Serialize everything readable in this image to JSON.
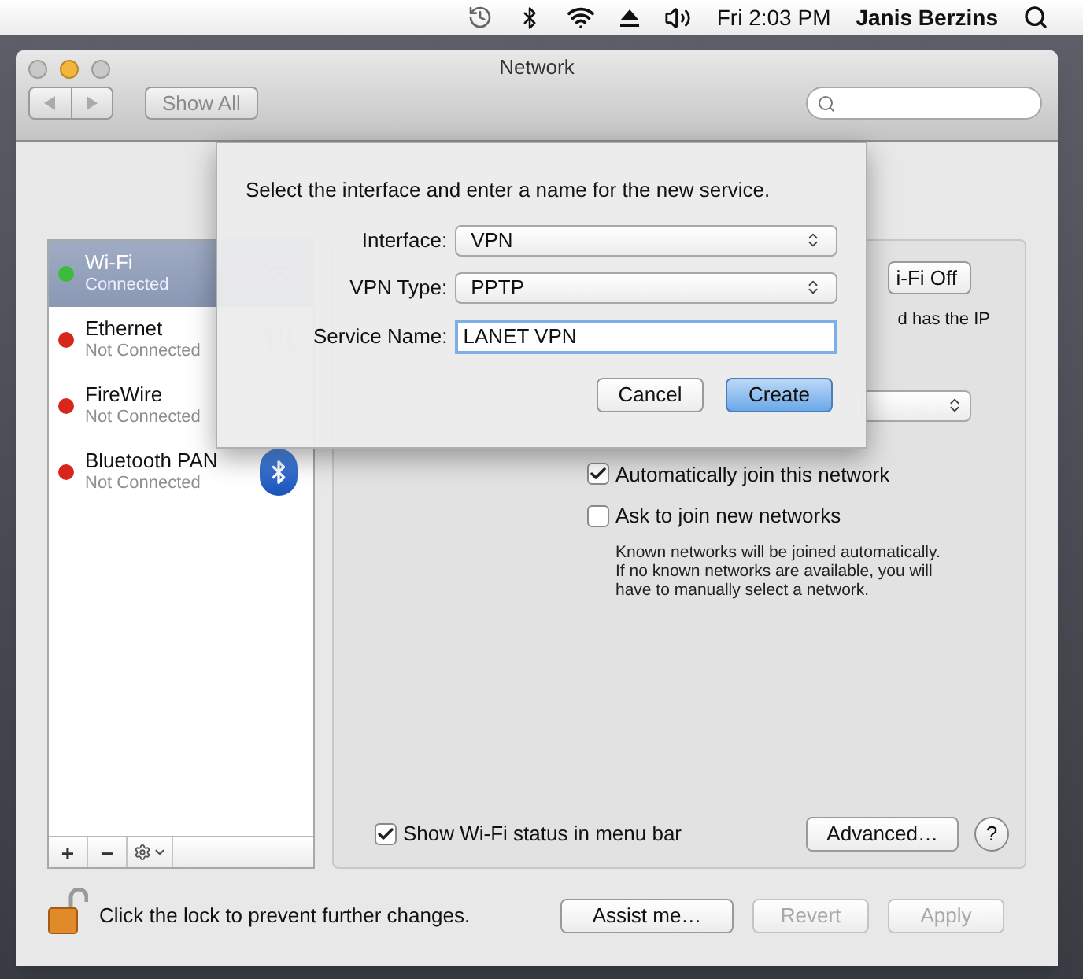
{
  "menubar": {
    "clock": "Fri 2:03 PM",
    "user": "Janis Berzins"
  },
  "window": {
    "title": "Network",
    "show_all": "Show All"
  },
  "services": [
    {
      "name": "Wi-Fi",
      "status": "Connected",
      "selected": true,
      "color": "#3dbb3a",
      "kind": "wifi"
    },
    {
      "name": "Ethernet",
      "status": "Not Connected",
      "selected": false,
      "color": "#d9261c",
      "kind": "ethernet"
    },
    {
      "name": "FireWire",
      "status": "Not Connected",
      "selected": false,
      "color": "#d9261c",
      "kind": "firewire"
    },
    {
      "name": "Bluetooth PAN",
      "status": "Not Connected",
      "selected": false,
      "color": "#d9261c",
      "kind": "bluetooth"
    }
  ],
  "list_controls": [
    "+",
    "−"
  ],
  "sheet": {
    "prompt": "Select the interface and enter a name for the new service.",
    "fields": [
      {
        "label": "Interface:",
        "kind": "select",
        "value": "VPN"
      },
      {
        "label": "VPN Type:",
        "kind": "select",
        "value": "PPTP"
      },
      {
        "label": "Service Name:",
        "kind": "text",
        "value": "LANET VPN"
      }
    ],
    "buttons": [
      {
        "label": "Cancel",
        "default": false
      },
      {
        "label": "Create",
        "default": true
      }
    ]
  },
  "detail": {
    "power_button": "i-Fi Off",
    "status_fragment": "d has the IP",
    "options": [
      {
        "label": "Automatically join this network",
        "checked": true
      },
      {
        "label": "Ask to join new networks",
        "checked": false
      }
    ],
    "note": "Known networks will be joined automatically. If no known networks are available, you will have to manually select a network.",
    "show_status": {
      "label": "Show Wi-Fi status in menu bar",
      "checked": true
    },
    "advanced": "Advanced…",
    "help": "?"
  },
  "lock": {
    "text": "Click the lock to prevent further changes.",
    "locked": false
  },
  "footer_buttons": [
    {
      "label": "Assist me…",
      "disabled": false
    },
    {
      "label": "Revert",
      "disabled": true
    },
    {
      "label": "Apply",
      "disabled": true
    }
  ]
}
